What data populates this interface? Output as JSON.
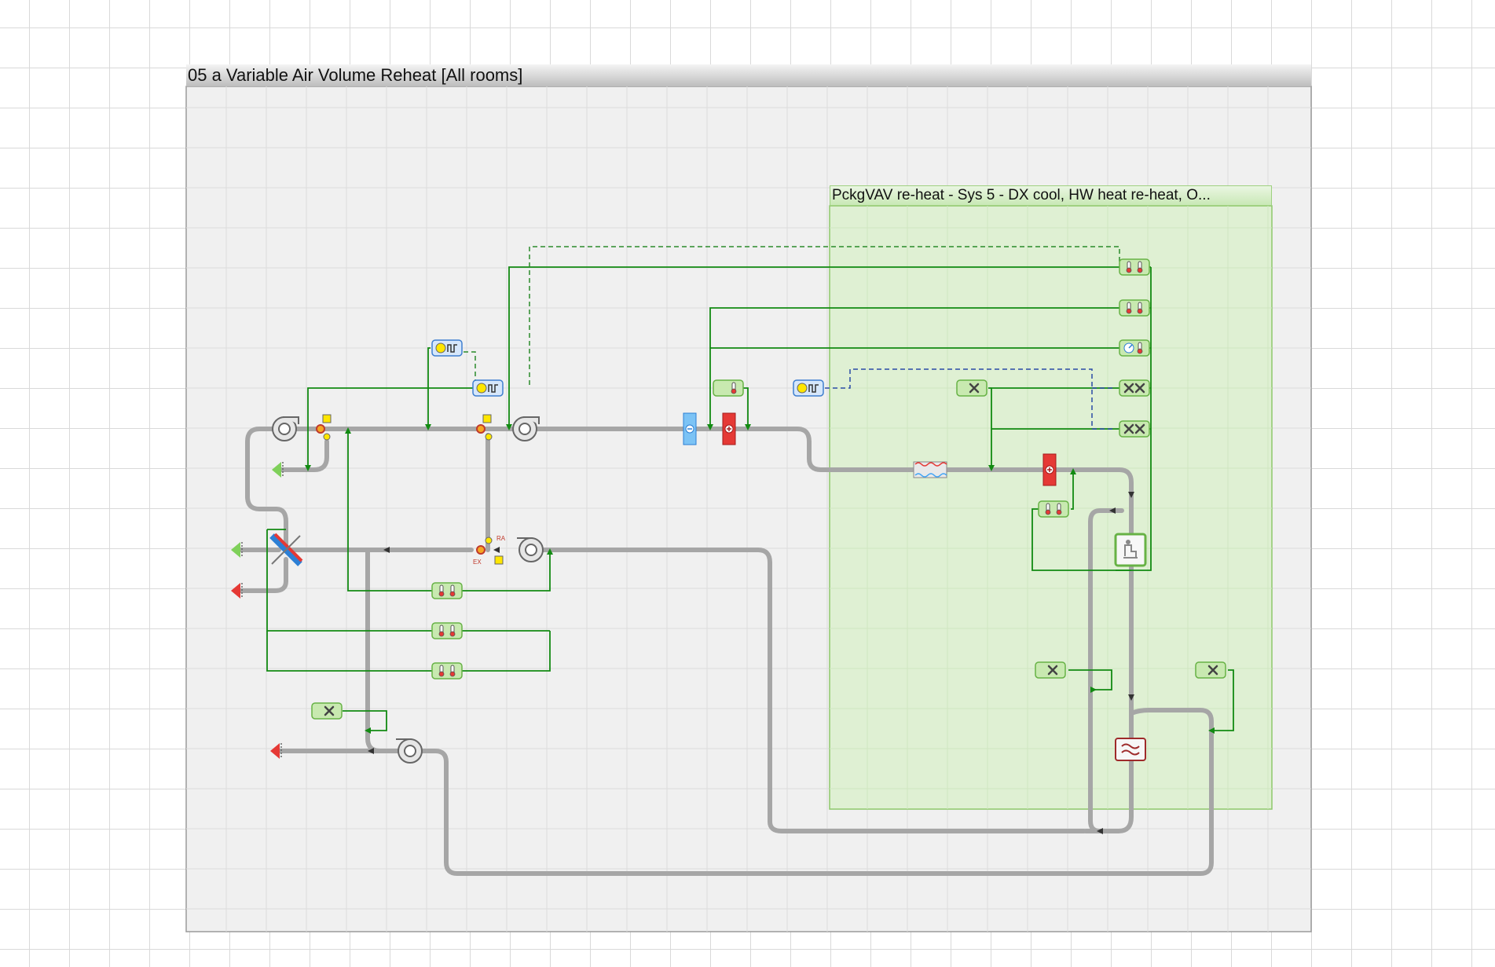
{
  "canvas": {
    "title": "05 a Variable Air Volume Reheat [All rooms]"
  },
  "group": {
    "title": "PckgVAV re-heat - Sys 5 - DX cool, HW heat  re-heat, O..."
  },
  "labels": {
    "relief_air": "RA",
    "exhaust_air": "EX"
  },
  "colors": {
    "duct": "#a6a6a6",
    "control_wire": "#128a12",
    "dashed_wire": "#2a4aa6",
    "group_fill": "#dff0d3",
    "group_border": "#8dc86b",
    "canvas_fill": "#f0f0f0",
    "heat_coil": "#e53935",
    "cool_coil": "#42a5f5",
    "controller_fill": "#c8e9b0",
    "timer_border": "#3f7fd0"
  },
  "icons": {
    "fan": "fan-icon",
    "mixing_damper": "damper-icon",
    "heat_coil": "heating-coil-icon",
    "cool_coil": "cooling-coil-icon",
    "heat_exchanger": "heat-exchanger-icon",
    "humidifier": "humidifier-icon",
    "room": "room-icon",
    "radiator": "radiator-icon",
    "thermostat": "thermometer-icon",
    "timer": "timer-icon",
    "air_inlet": "inlet-arrow-icon",
    "air_outlet": "outlet-arrow-icon"
  }
}
